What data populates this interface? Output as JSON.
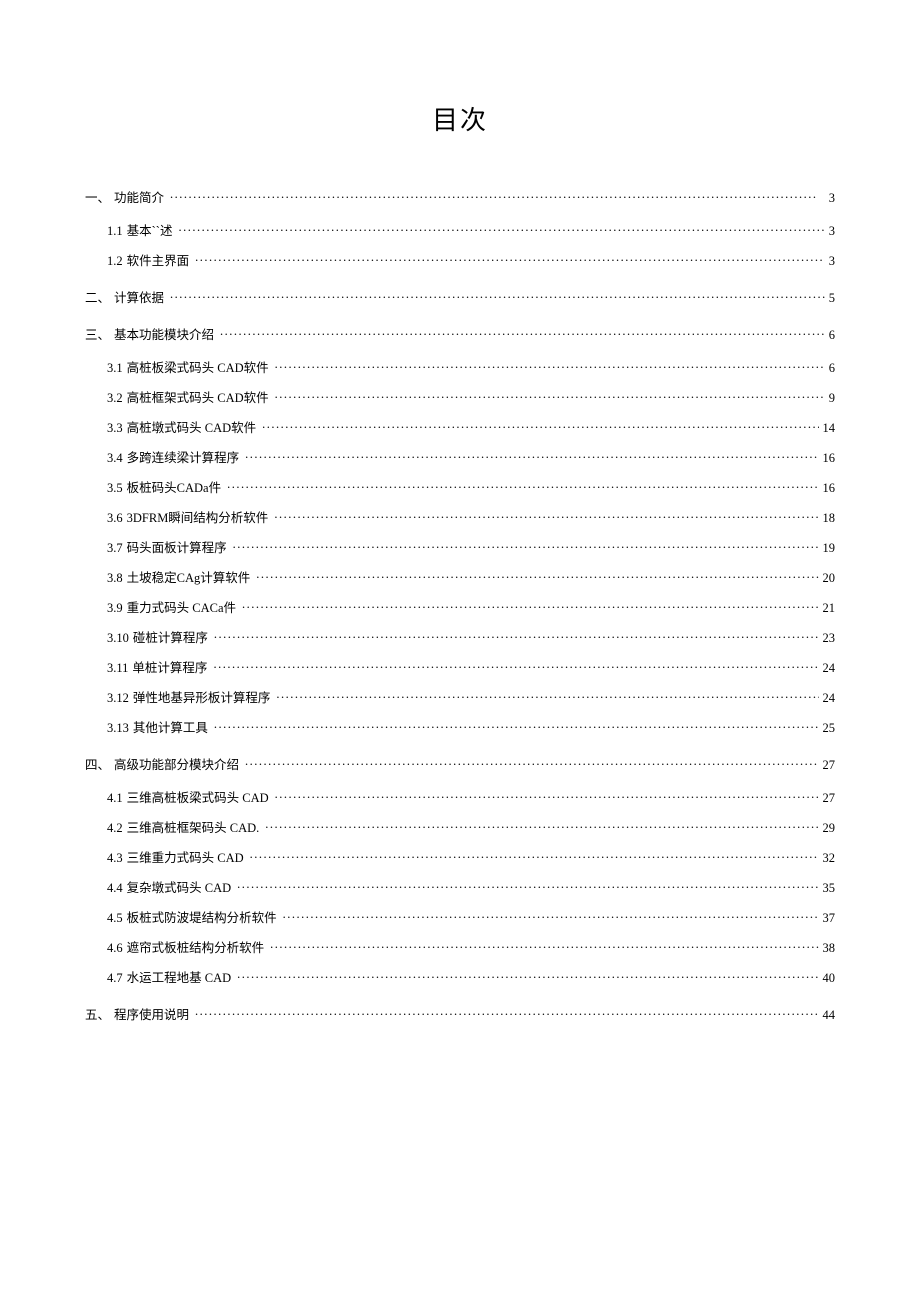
{
  "title": "目次",
  "toc": {
    "s1": {
      "num": "一、",
      "text": "功能简介",
      "page": "3"
    },
    "s1_1": {
      "num": "1.1",
      "text": "基本``述",
      "page": "3"
    },
    "s1_2": {
      "num": "1.2",
      "text": "软件主界面",
      "page": "3"
    },
    "s2": {
      "num": "二、",
      "text": "计算依据",
      "page": "5"
    },
    "s3": {
      "num": "三、",
      "text": "基本功能模块介绍",
      "page": "6"
    },
    "s3_1": {
      "num": "3.1",
      "text": "高桩板梁式码头 CAD软件",
      "page": "6"
    },
    "s3_2": {
      "num": "3.2",
      "text": "高桩框架式码头 CAD软件",
      "page": "9"
    },
    "s3_3": {
      "num": "3.3",
      "text": "高桩墩式码头 CAD软件",
      "page": "14"
    },
    "s3_4": {
      "num": "3.4",
      "text": "多跨连续梁计算程序",
      "page": "16"
    },
    "s3_5": {
      "num": "3.5",
      "text": "板桩码头CADa件",
      "page": "16"
    },
    "s3_6": {
      "num": "3.6",
      "text": "3DFRM瞬间结构分析软件",
      "page": "18"
    },
    "s3_7": {
      "num": "3.7",
      "text": "码头面板计算程序",
      "page": "19"
    },
    "s3_8": {
      "num": "3.8",
      "text": "土坡稳定CAg计算软件",
      "page": "20"
    },
    "s3_9": {
      "num": "3.9",
      "text": "重力式码头 CACa件",
      "page": "21"
    },
    "s3_10": {
      "num": "3.10",
      "text": "碰桩计算程序",
      "page": "23"
    },
    "s3_11": {
      "num": "3.11",
      "text": "单桩计算程序",
      "page": "24"
    },
    "s3_12": {
      "num": "3.12",
      "text": "弹性地基异形板计算程序",
      "page": "24"
    },
    "s3_13": {
      "num": "3.13",
      "text": "其他计算工具",
      "page": "25"
    },
    "s4": {
      "num": "四、",
      "text": "高级功能部分模块介绍",
      "page": "27"
    },
    "s4_1": {
      "num": "4.1",
      "text": "三维高桩板梁式码头 CAD",
      "page": "27"
    },
    "s4_2": {
      "num": "4.2",
      "text": "三维高桩框架码头 CAD.",
      "page": "29"
    },
    "s4_3": {
      "num": "4.3",
      "text": "三维重力式码头 CAD",
      "page": "32"
    },
    "s4_4": {
      "num": "4.4",
      "text": "复杂墩式码头 CAD",
      "page": "35"
    },
    "s4_5": {
      "num": "4.5",
      "text": "板桩式防波堤结构分析软件",
      "page": "37"
    },
    "s4_6": {
      "num": "4.6",
      "text": "遮帘式板桩结构分析软件",
      "page": "38"
    },
    "s4_7": {
      "num": "4.7",
      "text": "水运工程地基 CAD",
      "page": "40"
    },
    "s5": {
      "num": "五、",
      "text": "程序使用说明",
      "page": "44"
    }
  }
}
